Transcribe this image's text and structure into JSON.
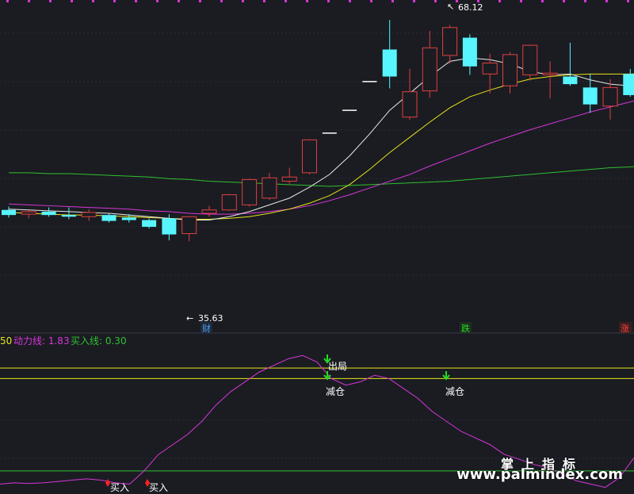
{
  "colors": {
    "background": "#1a1c22",
    "grid": "#2b2d36",
    "up": "#e0403f",
    "down": "#57f5ff",
    "ma_white": "#e9e9e9",
    "ma_yellow": "#e6e21a",
    "ma_magenta": "#d836d8",
    "ma_green": "#30c030",
    "signal_green": "#22dd22",
    "signal_red": "#ff2222",
    "label_blue": "#4a9ef0",
    "label_green": "#22dd22",
    "label_red": "#ff4040",
    "power_line": "#d836d8",
    "buy_line": "#30c030",
    "level_line": "#e6e21a",
    "text_white": "#ffffff"
  },
  "price_panel": {
    "high_label": "68.12",
    "low_label": "35.63",
    "markers": {
      "cai": "财",
      "die": "跌",
      "zhang": "涨"
    }
  },
  "indicator_panel": {
    "legend": {
      "prefix": "50",
      "power_label": "动力线: 1.83",
      "buy_label": "买入线: 0.30"
    },
    "signals": {
      "out": "出局",
      "reduce": "减仓",
      "buy": "买入"
    }
  },
  "watermark": {
    "cn": "掌上指标",
    "url": "www.palmindex.com"
  },
  "chart_data": {
    "type": "candlestick",
    "ylim": [
      33.5,
      70.5
    ],
    "candles": [
      {
        "o": 46.2,
        "h": 46.6,
        "l": 45.3,
        "c": 45.6
      },
      {
        "o": 45.7,
        "h": 46.2,
        "l": 45.2,
        "c": 46.0
      },
      {
        "o": 46.0,
        "h": 46.5,
        "l": 45.4,
        "c": 45.6
      },
      {
        "o": 45.6,
        "h": 46.5,
        "l": 45.1,
        "c": 45.4
      },
      {
        "o": 45.4,
        "h": 46.3,
        "l": 44.9,
        "c": 45.9
      },
      {
        "o": 45.6,
        "h": 45.8,
        "l": 44.7,
        "c": 44.9
      },
      {
        "o": 45.3,
        "h": 45.7,
        "l": 44.7,
        "c": 45.0
      },
      {
        "o": 45.0,
        "h": 45.2,
        "l": 44.0,
        "c": 44.2
      },
      {
        "o": 45.2,
        "h": 45.7,
        "l": 42.6,
        "c": 43.3
      },
      {
        "o": 43.4,
        "h": 45.5,
        "l": 42.5,
        "c": 45.4
      },
      {
        "o": 45.8,
        "h": 46.7,
        "l": 45.4,
        "c": 46.2
      },
      {
        "o": 46.2,
        "h": 48.1,
        "l": 46.1,
        "c": 48.0
      },
      {
        "o": 46.8,
        "h": 49.9,
        "l": 46.6,
        "c": 49.8
      },
      {
        "o": 47.6,
        "h": 50.6,
        "l": 47.4,
        "c": 50.0
      },
      {
        "o": 49.6,
        "h": 51.2,
        "l": 49.3,
        "c": 50.1
      },
      {
        "o": 50.6,
        "h": 54.6,
        "l": 50.4,
        "c": 54.5
      },
      {
        "o": 55.3,
        "h": 55.3,
        "l": 55.3,
        "c": 55.3
      },
      {
        "o": 58.0,
        "h": 58.0,
        "l": 58.0,
        "c": 58.0
      },
      {
        "o": 61.4,
        "h": 61.4,
        "l": 61.4,
        "c": 61.4
      },
      {
        "o": 65.2,
        "h": 68.7,
        "l": 60.6,
        "c": 62.0
      },
      {
        "o": 57.2,
        "h": 62.9,
        "l": 56.9,
        "c": 60.2
      },
      {
        "o": 60.3,
        "h": 67.4,
        "l": 59.5,
        "c": 65.4
      },
      {
        "o": 64.5,
        "h": 68.1,
        "l": 63.5,
        "c": 67.8
      },
      {
        "o": 66.6,
        "h": 67.0,
        "l": 62.2,
        "c": 63.2
      },
      {
        "o": 62.3,
        "h": 64.7,
        "l": 60.0,
        "c": 63.6
      },
      {
        "o": 60.9,
        "h": 64.9,
        "l": 60.0,
        "c": 64.6
      },
      {
        "o": 62.2,
        "h": 65.8,
        "l": 61.5,
        "c": 65.7
      },
      {
        "o": 62.2,
        "h": 63.8,
        "l": 59.4,
        "c": 62.4
      },
      {
        "o": 62.0,
        "h": 66.0,
        "l": 60.9,
        "c": 61.1
      },
      {
        "o": 60.7,
        "h": 62.3,
        "l": 57.7,
        "c": 58.7
      },
      {
        "o": 58.5,
        "h": 61.7,
        "l": 56.9,
        "c": 60.7
      },
      {
        "o": 62.3,
        "h": 62.9,
        "l": 59.6,
        "c": 59.8
      },
      {
        "o": 59.8,
        "h": 63.8,
        "l": 59.0,
        "c": 63.3
      }
    ],
    "ma_white": [
      46.3,
      46.2,
      46.1,
      46.0,
      45.9,
      45.8,
      45.6,
      45.4,
      45.2,
      45.0,
      45.0,
      45.4,
      46.0,
      46.8,
      47.6,
      48.9,
      50.4,
      52.6,
      55.2,
      58.0,
      60.0,
      62.0,
      63.8,
      64.2,
      64.0,
      63.5,
      62.6,
      62.2,
      62.3,
      61.6,
      61.1,
      60.9,
      60.8
    ],
    "ma_yellow": [
      45.9,
      45.8,
      45.7,
      45.6,
      45.6,
      45.5,
      45.4,
      45.3,
      45.2,
      45.1,
      45.1,
      45.2,
      45.4,
      45.8,
      46.3,
      47.0,
      47.9,
      49.2,
      51.0,
      53.0,
      54.8,
      56.6,
      58.3,
      59.6,
      60.4,
      61.1,
      61.7,
      62.0,
      62.2,
      62.3,
      62.3,
      62.3,
      62.4
    ],
    "ma_magenta": [
      46.9,
      46.8,
      46.7,
      46.6,
      46.5,
      46.4,
      46.3,
      46.1,
      46.0,
      45.8,
      45.7,
      45.7,
      45.8,
      46.0,
      46.3,
      46.7,
      47.3,
      48.0,
      48.8,
      49.6,
      50.4,
      51.4,
      52.3,
      53.2,
      54.1,
      54.9,
      55.7,
      56.4,
      57.1,
      57.8,
      58.4,
      59.0,
      59.6
    ],
    "ma_green": [
      50.6,
      50.6,
      50.5,
      50.5,
      50.4,
      50.3,
      50.2,
      50.1,
      49.9,
      49.8,
      49.6,
      49.5,
      49.4,
      49.3,
      49.2,
      49.1,
      49.0,
      49.1,
      49.2,
      49.3,
      49.4,
      49.5,
      49.6,
      49.8,
      50.0,
      50.2,
      50.4,
      50.6,
      50.8,
      51.0,
      51.2,
      51.3,
      51.5
    ],
    "indicator": {
      "power_line": [
        0.1,
        0.12,
        0.11,
        0.12,
        0.14,
        0.16,
        0.18,
        0.16,
        0.12,
        0.1,
        0.3,
        0.55,
        0.7,
        0.85,
        1.05,
        1.3,
        1.5,
        1.65,
        1.8,
        1.9,
        2.0,
        2.05,
        1.95,
        1.7,
        1.6,
        1.65,
        1.75,
        1.7,
        1.55,
        1.4,
        1.2,
        1.05,
        0.9,
        0.8,
        0.7,
        0.55,
        0.48,
        0.4,
        0.35,
        0.25,
        0.15,
        0.1,
        0.05,
        0.2,
        0.5
      ],
      "buy_line": 0.3,
      "levels": [
        1.86,
        1.7
      ]
    }
  }
}
